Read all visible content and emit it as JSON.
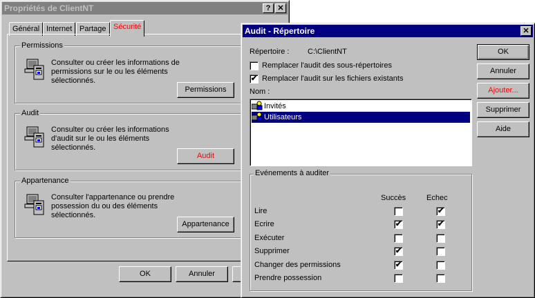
{
  "props_window": {
    "title": "Propriétés de ClientNT",
    "help_btn": "?",
    "close_btn": "✕",
    "tabs": [
      "Général",
      "Internet",
      "Partage",
      "Sécurité"
    ],
    "groups": {
      "permissions": {
        "title": "Permissions",
        "text": "Consulter ou créer les informations de permissions sur le ou les éléments sélectionnés.",
        "button": "Permissions"
      },
      "audit": {
        "title": "Audit",
        "text": "Consulter ou créer les informations d'audit sur le ou les éléments sélectionnés.",
        "button": "Audit"
      },
      "appartenance": {
        "title": "Appartenance",
        "text": "Consulter l'appartenance ou prendre possession du ou des éléments sélectionnés.",
        "button": "Appartenance"
      }
    },
    "footer": {
      "ok": "OK",
      "cancel": "Annuler"
    }
  },
  "audit_window": {
    "title": "Audit - Répertoire",
    "close_btn": "✕",
    "directory_label": "Répertoire :",
    "directory_value": "C:\\ClientNT",
    "checkbox_subdirs": {
      "label": "Remplacer l'audit des sous-répertoires",
      "checked": false
    },
    "checkbox_files": {
      "label": "Remplacer l'audit sur les fichiers existants",
      "checked": true
    },
    "name_label": "Nom :",
    "names": [
      {
        "label": "Invités",
        "selected": false
      },
      {
        "label": "Utilisateurs",
        "selected": true
      }
    ],
    "buttons": {
      "ok": "OK",
      "cancel": "Annuler",
      "add": "Ajouter...",
      "remove": "Supprimer",
      "help": "Aide"
    },
    "events_title": "Evénements à auditer",
    "col_success": "Succès",
    "col_failure": "Echec",
    "events": [
      {
        "label": "Lire",
        "success": false,
        "failure": true
      },
      {
        "label": "Ecrire",
        "success": true,
        "failure": true
      },
      {
        "label": "Exécuter",
        "success": false,
        "failure": false
      },
      {
        "label": "Supprimer",
        "success": true,
        "failure": false
      },
      {
        "label": "Changer des permissions",
        "success": true,
        "failure": false
      },
      {
        "label": "Prendre possession",
        "success": false,
        "failure": false
      }
    ],
    "colors": {
      "add_text": "#ff0000",
      "selected": "#000080"
    }
  }
}
